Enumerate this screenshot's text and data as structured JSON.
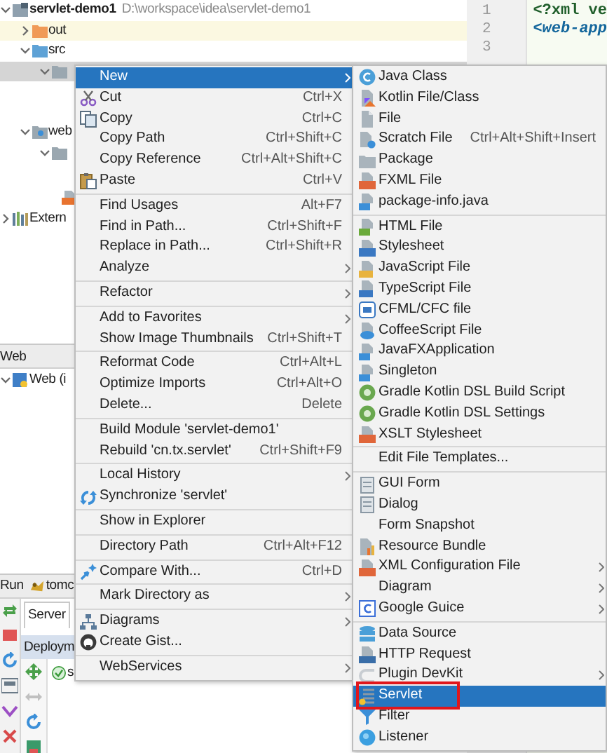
{
  "project_tree": [
    {
      "kind": "module",
      "label": "servlet-demo1",
      "path": "D:\\workspace\\idea\\servlet-demo1",
      "expanded": true,
      "selected": false,
      "children": [
        {
          "kind": "excluded-folder",
          "label": "out",
          "expanded": false,
          "selected": false
        },
        {
          "kind": "source-folder",
          "label": "src",
          "expanded": true,
          "selected": false,
          "children": [
            {
              "kind": "folder",
              "expanded": true,
              "selected": true
            }
          ]
        },
        {
          "kind": "web-folder",
          "label": "web",
          "expanded": true,
          "selected": false,
          "children": [
            {
              "kind": "folder",
              "expanded": true,
              "selected": false,
              "children": [
                {
                  "kind": "jsp-file",
                  "selected": false
                }
              ]
            }
          ]
        }
      ]
    },
    {
      "kind": "library",
      "label": "Extern",
      "expanded": false,
      "selected": false
    }
  ],
  "editor": {
    "lines": [
      {
        "number": "1",
        "code": "<?xml ve",
        "kind": "declaration"
      },
      {
        "number": "2",
        "code": "<web-app",
        "kind": "tag"
      },
      {
        "number": "3"
      }
    ]
  },
  "web_panel": {
    "title": "Web",
    "items": [
      {
        "label": "Web (i",
        "expanded": true
      }
    ]
  },
  "run_panel": {
    "title": "Run",
    "configuration": "tomc",
    "tabs": [
      {
        "label": "Server",
        "selected": true
      }
    ],
    "deployment": {
      "header": "Deploym",
      "items": [
        {
          "label": "s",
          "deployed": true
        }
      ]
    }
  },
  "context_menu": {
    "groups": [
      {
        "items": [
          {
            "label": "New",
            "submenu": true,
            "selected": true
          },
          {
            "label": "Cut",
            "shortcut": "Ctrl+X",
            "selected": false
          },
          {
            "label": "Copy",
            "shortcut": "Ctrl+C",
            "selected": false
          },
          {
            "label": "Copy Path",
            "shortcut": "Ctrl+Shift+C",
            "selected": false
          },
          {
            "label": "Copy Reference",
            "shortcut": "Ctrl+Alt+Shift+C",
            "selected": false
          },
          {
            "label": "Paste",
            "shortcut": "Ctrl+V",
            "selected": false
          }
        ]
      },
      {
        "items": [
          {
            "label": "Find Usages",
            "shortcut": "Alt+F7",
            "selected": false
          },
          {
            "label": "Find in Path...",
            "shortcut": "Ctrl+Shift+F",
            "selected": false
          },
          {
            "label": "Replace in Path...",
            "shortcut": "Ctrl+Shift+R",
            "selected": false
          },
          {
            "label": "Analyze",
            "submenu": true,
            "selected": false
          }
        ]
      },
      {
        "items": [
          {
            "label": "Refactor",
            "submenu": true,
            "selected": false
          }
        ]
      },
      {
        "items": [
          {
            "label": "Add to Favorites",
            "submenu": true,
            "selected": false
          },
          {
            "label": "Show Image Thumbnails",
            "shortcut": "Ctrl+Shift+T",
            "selected": false
          }
        ]
      },
      {
        "items": [
          {
            "label": "Reformat Code",
            "shortcut": "Ctrl+Alt+L",
            "selected": false
          },
          {
            "label": "Optimize Imports",
            "shortcut": "Ctrl+Alt+O",
            "selected": false
          },
          {
            "label": "Delete...",
            "shortcut": "Delete",
            "selected": false
          }
        ]
      },
      {
        "items": [
          {
            "label": "Build Module 'servlet-demo1'",
            "selected": false
          },
          {
            "label": "Rebuild 'cn.tx.servlet'",
            "shortcut": "Ctrl+Shift+F9",
            "selected": false
          }
        ]
      },
      {
        "items": [
          {
            "label": "Local History",
            "submenu": true,
            "selected": false
          },
          {
            "label": "Synchronize 'servlet'",
            "selected": false
          }
        ]
      },
      {
        "items": [
          {
            "label": "Show in Explorer",
            "selected": false
          }
        ]
      },
      {
        "items": [
          {
            "label": "Directory Path",
            "shortcut": "Ctrl+Alt+F12",
            "selected": false
          }
        ]
      },
      {
        "items": [
          {
            "label": "Compare With...",
            "shortcut": "Ctrl+D",
            "selected": false
          }
        ]
      },
      {
        "items": [
          {
            "label": "Mark Directory as",
            "submenu": true,
            "selected": false
          }
        ]
      },
      {
        "items": [
          {
            "label": "Diagrams",
            "submenu": true,
            "selected": false
          },
          {
            "label": "Create Gist...",
            "selected": false
          }
        ]
      },
      {
        "items": [
          {
            "label": "WebServices",
            "submenu": true,
            "selected": false
          }
        ]
      }
    ]
  },
  "new_submenu": {
    "groups": [
      {
        "items": [
          {
            "label": "Java Class",
            "selected": false
          },
          {
            "label": "Kotlin File/Class",
            "selected": false
          },
          {
            "label": "File",
            "selected": false
          },
          {
            "label": "Scratch File",
            "shortcut": "Ctrl+Alt+Shift+Insert",
            "selected": false
          },
          {
            "label": "Package",
            "selected": false
          },
          {
            "label": "FXML File",
            "selected": false
          },
          {
            "label": "package-info.java",
            "selected": false
          }
        ]
      },
      {
        "items": [
          {
            "label": "HTML File",
            "selected": false
          },
          {
            "label": "Stylesheet",
            "selected": false
          },
          {
            "label": "JavaScript File",
            "selected": false
          },
          {
            "label": "TypeScript File",
            "selected": false
          },
          {
            "label": "CFML/CFC file",
            "selected": false
          },
          {
            "label": "CoffeeScript File",
            "selected": false
          },
          {
            "label": "JavaFXApplication",
            "selected": false
          },
          {
            "label": "Singleton",
            "selected": false
          },
          {
            "label": "Gradle Kotlin DSL Build Script",
            "selected": false
          },
          {
            "label": "Gradle Kotlin DSL Settings",
            "selected": false
          },
          {
            "label": "XSLT Stylesheet",
            "selected": false
          }
        ]
      },
      {
        "items": [
          {
            "label": "Edit File Templates...",
            "selected": false
          }
        ]
      },
      {
        "items": [
          {
            "label": "GUI Form",
            "selected": false
          },
          {
            "label": "Dialog",
            "selected": false
          },
          {
            "label": "Form Snapshot",
            "selected": false
          },
          {
            "label": "Resource Bundle",
            "selected": false
          },
          {
            "label": "XML Configuration File",
            "submenu": true,
            "selected": false
          },
          {
            "label": "Diagram",
            "submenu": true,
            "selected": false
          },
          {
            "label": "Google Guice",
            "submenu": true,
            "selected": false
          }
        ]
      },
      {
        "items": [
          {
            "label": "Data Source",
            "selected": false
          },
          {
            "label": "HTTP Request",
            "selected": false
          },
          {
            "label": "Plugin DevKit",
            "submenu": true,
            "selected": false
          },
          {
            "label": "Servlet",
            "selected": true,
            "outlined": true
          },
          {
            "label": "Filter",
            "selected": false
          },
          {
            "label": "Listener",
            "selected": false
          }
        ]
      }
    ]
  }
}
